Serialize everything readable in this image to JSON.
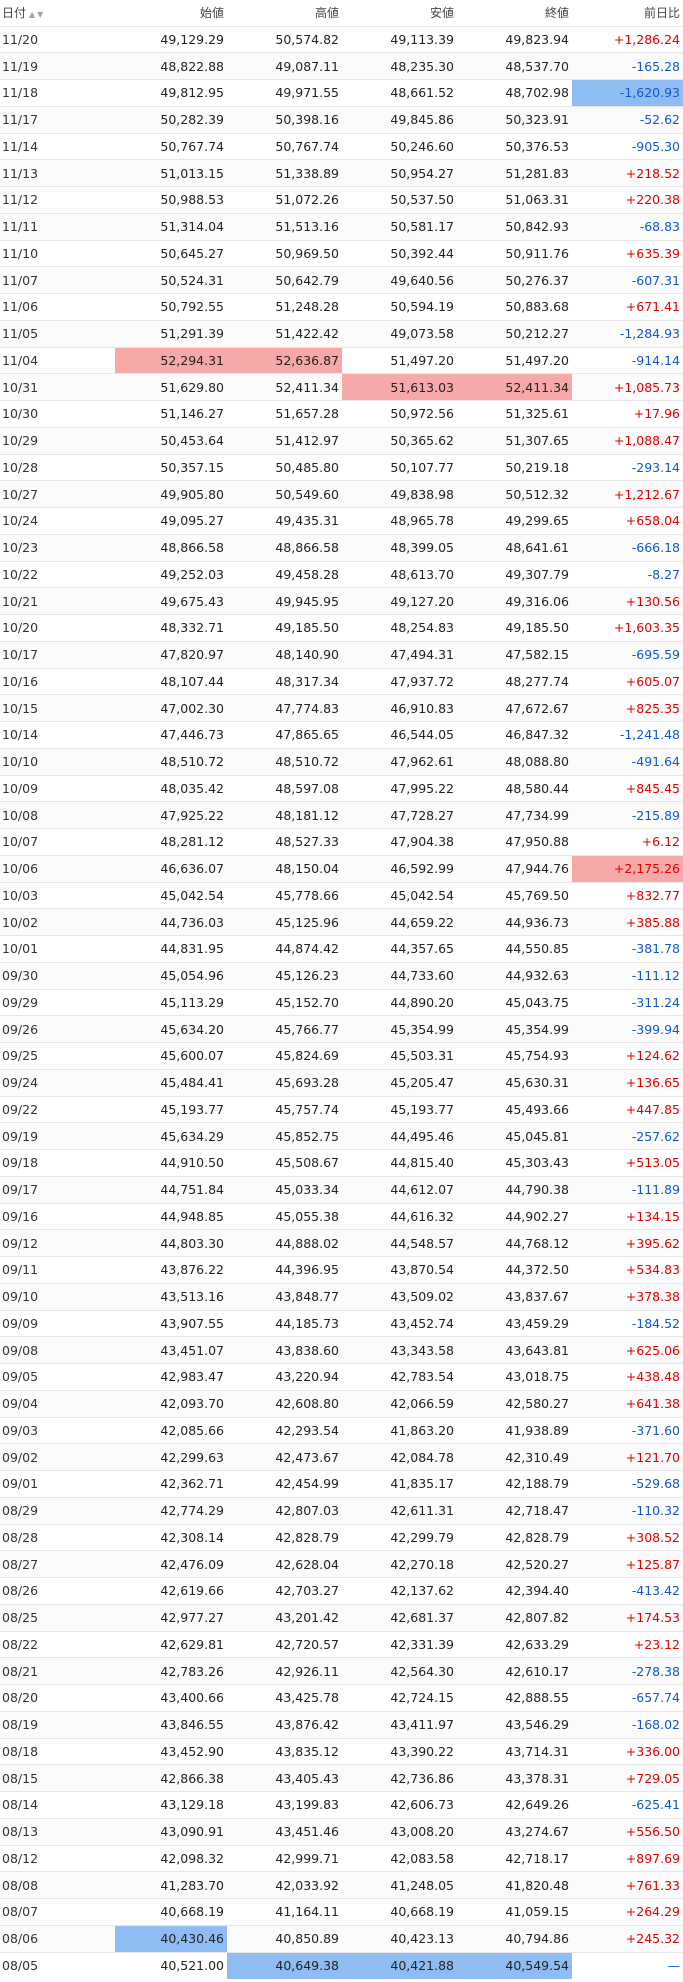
{
  "header": {
    "date": "日付",
    "open": "始値",
    "high": "高値",
    "low": "安値",
    "close": "終値",
    "change": "前日比",
    "sort_icon": "sort-asc-desc-icon"
  },
  "colors": {
    "positive": "#e00000",
    "negative": "#1258c8",
    "highlight_max": "#f7a9a9",
    "highlight_min": "#8fbdf3"
  },
  "rows": [
    {
      "date": "11/20",
      "open": "49,129.29",
      "high": "50,574.82",
      "low": "49,113.39",
      "close": "49,823.94",
      "change": "+1,286.24",
      "dir": "pos"
    },
    {
      "date": "11/19",
      "open": "48,822.88",
      "high": "49,087.11",
      "low": "48,235.30",
      "close": "48,537.70",
      "change": "-165.28",
      "dir": "neg"
    },
    {
      "date": "11/18",
      "open": "49,812.95",
      "high": "49,971.55",
      "low": "48,661.52",
      "close": "48,702.98",
      "change": "-1,620.93",
      "dir": "neg",
      "hl": {
        "change": "min"
      }
    },
    {
      "date": "11/17",
      "open": "50,282.39",
      "high": "50,398.16",
      "low": "49,845.86",
      "close": "50,323.91",
      "change": "-52.62",
      "dir": "neg"
    },
    {
      "date": "11/14",
      "open": "50,767.74",
      "high": "50,767.74",
      "low": "50,246.60",
      "close": "50,376.53",
      "change": "-905.30",
      "dir": "neg"
    },
    {
      "date": "11/13",
      "open": "51,013.15",
      "high": "51,338.89",
      "low": "50,954.27",
      "close": "51,281.83",
      "change": "+218.52",
      "dir": "pos"
    },
    {
      "date": "11/12",
      "open": "50,988.53",
      "high": "51,072.26",
      "low": "50,537.50",
      "close": "51,063.31",
      "change": "+220.38",
      "dir": "pos"
    },
    {
      "date": "11/11",
      "open": "51,314.04",
      "high": "51,513.16",
      "low": "50,581.17",
      "close": "50,842.93",
      "change": "-68.83",
      "dir": "neg"
    },
    {
      "date": "11/10",
      "open": "50,645.27",
      "high": "50,969.50",
      "low": "50,392.44",
      "close": "50,911.76",
      "change": "+635.39",
      "dir": "pos"
    },
    {
      "date": "11/07",
      "open": "50,524.31",
      "high": "50,642.79",
      "low": "49,640.56",
      "close": "50,276.37",
      "change": "-607.31",
      "dir": "neg"
    },
    {
      "date": "11/06",
      "open": "50,792.55",
      "high": "51,248.28",
      "low": "50,594.19",
      "close": "50,883.68",
      "change": "+671.41",
      "dir": "pos"
    },
    {
      "date": "11/05",
      "open": "51,291.39",
      "high": "51,422.42",
      "low": "49,073.58",
      "close": "50,212.27",
      "change": "-1,284.93",
      "dir": "neg"
    },
    {
      "date": "11/04",
      "open": "52,294.31",
      "high": "52,636.87",
      "low": "51,497.20",
      "close": "51,497.20",
      "change": "-914.14",
      "dir": "neg",
      "hl": {
        "open": "max",
        "high": "max"
      }
    },
    {
      "date": "10/31",
      "open": "51,629.80",
      "high": "52,411.34",
      "low": "51,613.03",
      "close": "52,411.34",
      "change": "+1,085.73",
      "dir": "pos",
      "hl": {
        "low": "max",
        "close": "max"
      }
    },
    {
      "date": "10/30",
      "open": "51,146.27",
      "high": "51,657.28",
      "low": "50,972.56",
      "close": "51,325.61",
      "change": "+17.96",
      "dir": "pos"
    },
    {
      "date": "10/29",
      "open": "50,453.64",
      "high": "51,412.97",
      "low": "50,365.62",
      "close": "51,307.65",
      "change": "+1,088.47",
      "dir": "pos"
    },
    {
      "date": "10/28",
      "open": "50,357.15",
      "high": "50,485.80",
      "low": "50,107.77",
      "close": "50,219.18",
      "change": "-293.14",
      "dir": "neg"
    },
    {
      "date": "10/27",
      "open": "49,905.80",
      "high": "50,549.60",
      "low": "49,838.98",
      "close": "50,512.32",
      "change": "+1,212.67",
      "dir": "pos"
    },
    {
      "date": "10/24",
      "open": "49,095.27",
      "high": "49,435.31",
      "low": "48,965.78",
      "close": "49,299.65",
      "change": "+658.04",
      "dir": "pos"
    },
    {
      "date": "10/23",
      "open": "48,866.58",
      "high": "48,866.58",
      "low": "48,399.05",
      "close": "48,641.61",
      "change": "-666.18",
      "dir": "neg"
    },
    {
      "date": "10/22",
      "open": "49,252.03",
      "high": "49,458.28",
      "low": "48,613.70",
      "close": "49,307.79",
      "change": "-8.27",
      "dir": "neg"
    },
    {
      "date": "10/21",
      "open": "49,675.43",
      "high": "49,945.95",
      "low": "49,127.20",
      "close": "49,316.06",
      "change": "+130.56",
      "dir": "pos"
    },
    {
      "date": "10/20",
      "open": "48,332.71",
      "high": "49,185.50",
      "low": "48,254.83",
      "close": "49,185.50",
      "change": "+1,603.35",
      "dir": "pos"
    },
    {
      "date": "10/17",
      "open": "47,820.97",
      "high": "48,140.90",
      "low": "47,494.31",
      "close": "47,582.15",
      "change": "-695.59",
      "dir": "neg"
    },
    {
      "date": "10/16",
      "open": "48,107.44",
      "high": "48,317.34",
      "low": "47,937.72",
      "close": "48,277.74",
      "change": "+605.07",
      "dir": "pos"
    },
    {
      "date": "10/15",
      "open": "47,002.30",
      "high": "47,774.83",
      "low": "46,910.83",
      "close": "47,672.67",
      "change": "+825.35",
      "dir": "pos"
    },
    {
      "date": "10/14",
      "open": "47,446.73",
      "high": "47,865.65",
      "low": "46,544.05",
      "close": "46,847.32",
      "change": "-1,241.48",
      "dir": "neg"
    },
    {
      "date": "10/10",
      "open": "48,510.72",
      "high": "48,510.72",
      "low": "47,962.61",
      "close": "48,088.80",
      "change": "-491.64",
      "dir": "neg"
    },
    {
      "date": "10/09",
      "open": "48,035.42",
      "high": "48,597.08",
      "low": "47,995.22",
      "close": "48,580.44",
      "change": "+845.45",
      "dir": "pos"
    },
    {
      "date": "10/08",
      "open": "47,925.22",
      "high": "48,181.12",
      "low": "47,728.27",
      "close": "47,734.99",
      "change": "-215.89",
      "dir": "neg"
    },
    {
      "date": "10/07",
      "open": "48,281.12",
      "high": "48,527.33",
      "low": "47,904.38",
      "close": "47,950.88",
      "change": "+6.12",
      "dir": "pos"
    },
    {
      "date": "10/06",
      "open": "46,636.07",
      "high": "48,150.04",
      "low": "46,592.99",
      "close": "47,944.76",
      "change": "+2,175.26",
      "dir": "pos",
      "hl": {
        "change": "max"
      }
    },
    {
      "date": "10/03",
      "open": "45,042.54",
      "high": "45,778.66",
      "low": "45,042.54",
      "close": "45,769.50",
      "change": "+832.77",
      "dir": "pos"
    },
    {
      "date": "10/02",
      "open": "44,736.03",
      "high": "45,125.96",
      "low": "44,659.22",
      "close": "44,936.73",
      "change": "+385.88",
      "dir": "pos"
    },
    {
      "date": "10/01",
      "open": "44,831.95",
      "high": "44,874.42",
      "low": "44,357.65",
      "close": "44,550.85",
      "change": "-381.78",
      "dir": "neg"
    },
    {
      "date": "09/30",
      "open": "45,054.96",
      "high": "45,126.23",
      "low": "44,733.60",
      "close": "44,932.63",
      "change": "-111.12",
      "dir": "neg"
    },
    {
      "date": "09/29",
      "open": "45,113.29",
      "high": "45,152.70",
      "low": "44,890.20",
      "close": "45,043.75",
      "change": "-311.24",
      "dir": "neg"
    },
    {
      "date": "09/26",
      "open": "45,634.20",
      "high": "45,766.77",
      "low": "45,354.99",
      "close": "45,354.99",
      "change": "-399.94",
      "dir": "neg"
    },
    {
      "date": "09/25",
      "open": "45,600.07",
      "high": "45,824.69",
      "low": "45,503.31",
      "close": "45,754.93",
      "change": "+124.62",
      "dir": "pos"
    },
    {
      "date": "09/24",
      "open": "45,484.41",
      "high": "45,693.28",
      "low": "45,205.47",
      "close": "45,630.31",
      "change": "+136.65",
      "dir": "pos"
    },
    {
      "date": "09/22",
      "open": "45,193.77",
      "high": "45,757.74",
      "low": "45,193.77",
      "close": "45,493.66",
      "change": "+447.85",
      "dir": "pos"
    },
    {
      "date": "09/19",
      "open": "45,634.29",
      "high": "45,852.75",
      "low": "44,495.46",
      "close": "45,045.81",
      "change": "-257.62",
      "dir": "neg"
    },
    {
      "date": "09/18",
      "open": "44,910.50",
      "high": "45,508.67",
      "low": "44,815.40",
      "close": "45,303.43",
      "change": "+513.05",
      "dir": "pos"
    },
    {
      "date": "09/17",
      "open": "44,751.84",
      "high": "45,033.34",
      "low": "44,612.07",
      "close": "44,790.38",
      "change": "-111.89",
      "dir": "neg"
    },
    {
      "date": "09/16",
      "open": "44,948.85",
      "high": "45,055.38",
      "low": "44,616.32",
      "close": "44,902.27",
      "change": "+134.15",
      "dir": "pos"
    },
    {
      "date": "09/12",
      "open": "44,803.30",
      "high": "44,888.02",
      "low": "44,548.57",
      "close": "44,768.12",
      "change": "+395.62",
      "dir": "pos"
    },
    {
      "date": "09/11",
      "open": "43,876.22",
      "high": "44,396.95",
      "low": "43,870.54",
      "close": "44,372.50",
      "change": "+534.83",
      "dir": "pos"
    },
    {
      "date": "09/10",
      "open": "43,513.16",
      "high": "43,848.77",
      "low": "43,509.02",
      "close": "43,837.67",
      "change": "+378.38",
      "dir": "pos"
    },
    {
      "date": "09/09",
      "open": "43,907.55",
      "high": "44,185.73",
      "low": "43,452.74",
      "close": "43,459.29",
      "change": "-184.52",
      "dir": "neg"
    },
    {
      "date": "09/08",
      "open": "43,451.07",
      "high": "43,838.60",
      "low": "43,343.58",
      "close": "43,643.81",
      "change": "+625.06",
      "dir": "pos"
    },
    {
      "date": "09/05",
      "open": "42,983.47",
      "high": "43,220.94",
      "low": "42,783.54",
      "close": "43,018.75",
      "change": "+438.48",
      "dir": "pos"
    },
    {
      "date": "09/04",
      "open": "42,093.70",
      "high": "42,608.80",
      "low": "42,066.59",
      "close": "42,580.27",
      "change": "+641.38",
      "dir": "pos"
    },
    {
      "date": "09/03",
      "open": "42,085.66",
      "high": "42,293.54",
      "low": "41,863.20",
      "close": "41,938.89",
      "change": "-371.60",
      "dir": "neg"
    },
    {
      "date": "09/02",
      "open": "42,299.63",
      "high": "42,473.67",
      "low": "42,084.78",
      "close": "42,310.49",
      "change": "+121.70",
      "dir": "pos"
    },
    {
      "date": "09/01",
      "open": "42,362.71",
      "high": "42,454.99",
      "low": "41,835.17",
      "close": "42,188.79",
      "change": "-529.68",
      "dir": "neg"
    },
    {
      "date": "08/29",
      "open": "42,774.29",
      "high": "42,807.03",
      "low": "42,611.31",
      "close": "42,718.47",
      "change": "-110.32",
      "dir": "neg"
    },
    {
      "date": "08/28",
      "open": "42,308.14",
      "high": "42,828.79",
      "low": "42,299.79",
      "close": "42,828.79",
      "change": "+308.52",
      "dir": "pos"
    },
    {
      "date": "08/27",
      "open": "42,476.09",
      "high": "42,628.04",
      "low": "42,270.18",
      "close": "42,520.27",
      "change": "+125.87",
      "dir": "pos"
    },
    {
      "date": "08/26",
      "open": "42,619.66",
      "high": "42,703.27",
      "low": "42,137.62",
      "close": "42,394.40",
      "change": "-413.42",
      "dir": "neg"
    },
    {
      "date": "08/25",
      "open": "42,977.27",
      "high": "43,201.42",
      "low": "42,681.37",
      "close": "42,807.82",
      "change": "+174.53",
      "dir": "pos"
    },
    {
      "date": "08/22",
      "open": "42,629.81",
      "high": "42,720.57",
      "low": "42,331.39",
      "close": "42,633.29",
      "change": "+23.12",
      "dir": "pos"
    },
    {
      "date": "08/21",
      "open": "42,783.26",
      "high": "42,926.11",
      "low": "42,564.30",
      "close": "42,610.17",
      "change": "-278.38",
      "dir": "neg"
    },
    {
      "date": "08/20",
      "open": "43,400.66",
      "high": "43,425.78",
      "low": "42,724.15",
      "close": "42,888.55",
      "change": "-657.74",
      "dir": "neg"
    },
    {
      "date": "08/19",
      "open": "43,846.55",
      "high": "43,876.42",
      "low": "43,411.97",
      "close": "43,546.29",
      "change": "-168.02",
      "dir": "neg"
    },
    {
      "date": "08/18",
      "open": "43,452.90",
      "high": "43,835.12",
      "low": "43,390.22",
      "close": "43,714.31",
      "change": "+336.00",
      "dir": "pos"
    },
    {
      "date": "08/15",
      "open": "42,866.38",
      "high": "43,405.43",
      "low": "42,736.86",
      "close": "43,378.31",
      "change": "+729.05",
      "dir": "pos"
    },
    {
      "date": "08/14",
      "open": "43,129.18",
      "high": "43,199.83",
      "low": "42,606.73",
      "close": "42,649.26",
      "change": "-625.41",
      "dir": "neg"
    },
    {
      "date": "08/13",
      "open": "43,090.91",
      "high": "43,451.46",
      "low": "43,008.20",
      "close": "43,274.67",
      "change": "+556.50",
      "dir": "pos"
    },
    {
      "date": "08/12",
      "open": "42,098.32",
      "high": "42,999.71",
      "low": "42,083.58",
      "close": "42,718.17",
      "change": "+897.69",
      "dir": "pos"
    },
    {
      "date": "08/08",
      "open": "41,283.70",
      "high": "42,033.92",
      "low": "41,248.05",
      "close": "41,820.48",
      "change": "+761.33",
      "dir": "pos"
    },
    {
      "date": "08/07",
      "open": "40,668.19",
      "high": "41,164.11",
      "low": "40,668.19",
      "close": "41,059.15",
      "change": "+264.29",
      "dir": "pos"
    },
    {
      "date": "08/06",
      "open": "40,430.46",
      "high": "40,850.89",
      "low": "40,423.13",
      "close": "40,794.86",
      "change": "+245.32",
      "dir": "pos",
      "hl": {
        "open": "min"
      }
    },
    {
      "date": "08/05",
      "open": "40,521.00",
      "high": "40,649.38",
      "low": "40,421.88",
      "close": "40,549.54",
      "change": "—",
      "dir": "neu",
      "hl": {
        "high": "min",
        "low": "min",
        "close": "min"
      }
    }
  ]
}
